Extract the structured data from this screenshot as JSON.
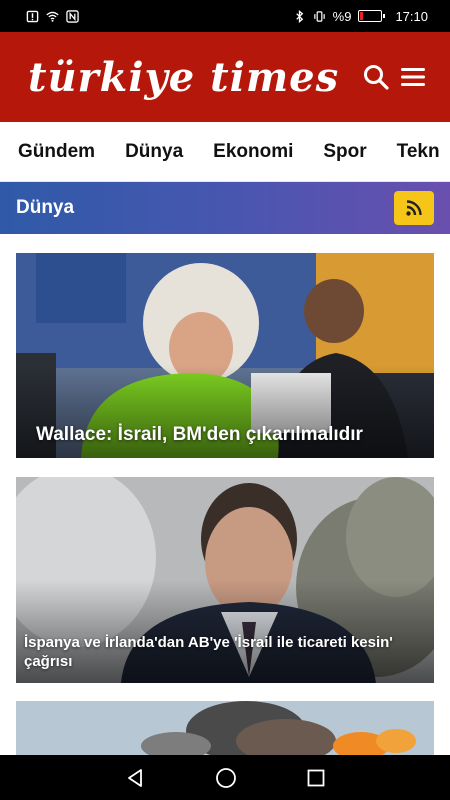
{
  "status_bar": {
    "battery_percent": "%9",
    "time": "17:10"
  },
  "header": {
    "logo": "türkiye times",
    "icons": [
      "search-icon",
      "menu-icon"
    ]
  },
  "nav": {
    "items": [
      "Gündem",
      "Dünya",
      "Ekonomi",
      "Spor",
      "Tekn"
    ]
  },
  "section": {
    "title": "Dünya",
    "rss_icon": "rss-icon"
  },
  "articles": [
    {
      "title": "Wallace: İsrail, BM'den çıkarılmalıdır"
    },
    {
      "title": "İspanya ve İrlanda'dan AB'ye 'İsrail ile ticareti kesin' çağrısı"
    },
    {
      "title": ""
    }
  ],
  "colors": {
    "header_red": "#b5180a",
    "rss_yellow": "#f5c518",
    "section_blue": "#2f5aa8",
    "section_purple": "#6a4fae"
  }
}
